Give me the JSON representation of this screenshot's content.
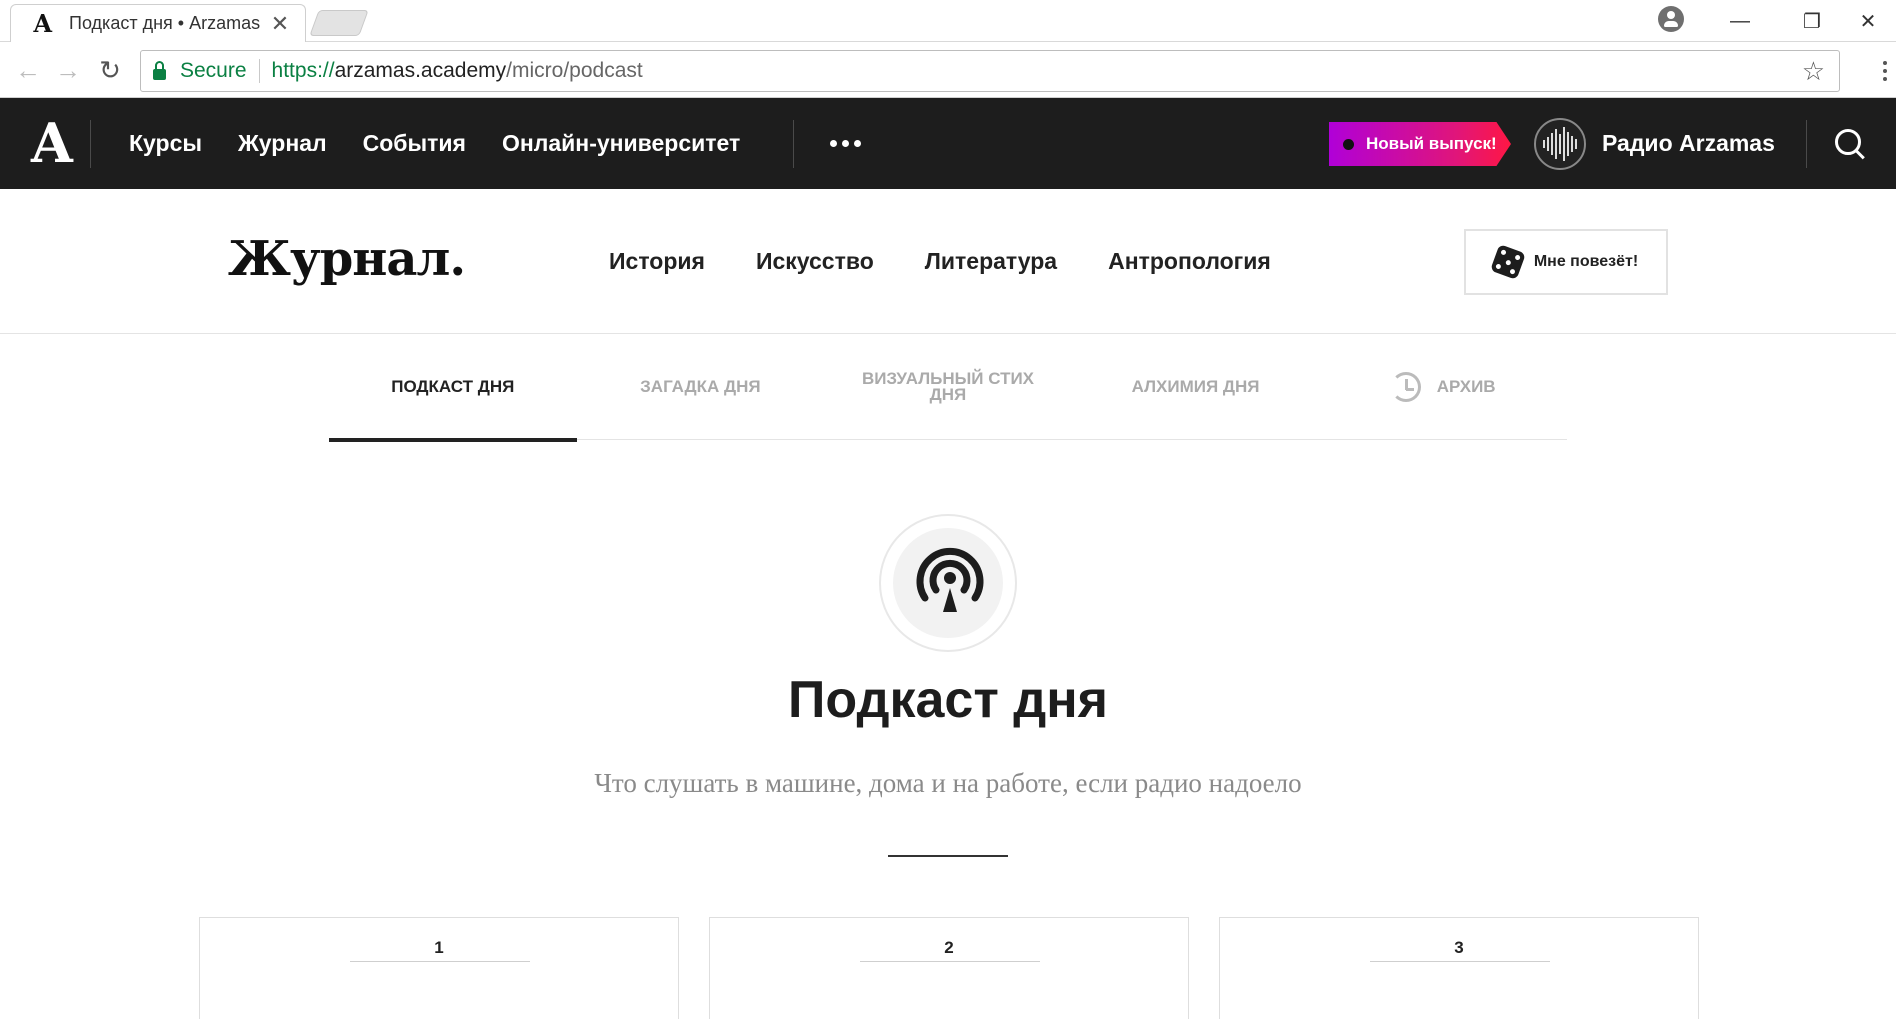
{
  "browser": {
    "tab_title": "Подкаст дня • Arzamas",
    "tab_favicon": "А",
    "secure_label": "Secure",
    "url_proto": "https://",
    "url_host": "arzamas.academy",
    "url_path": "/micro/podcast"
  },
  "header": {
    "logo": "А",
    "nav": [
      "Курсы",
      "Журнал",
      "События",
      "Онлайн-университет"
    ],
    "new_badge": "Новый выпуск!",
    "radio_label": "Радио Arzamas"
  },
  "journal": {
    "logo": "Журнал.",
    "nav": [
      "История",
      "Искусство",
      "Литература",
      "Антропология"
    ],
    "lucky_label": "Мне повезёт!"
  },
  "tabs": [
    {
      "label": "Подкаст дня",
      "active": true
    },
    {
      "label": "Загадка дня",
      "active": false
    },
    {
      "label": "Визуальный стих дня",
      "active": false
    },
    {
      "label": "Алхимия дня",
      "active": false
    },
    {
      "label": "Архив",
      "active": false
    }
  ],
  "hero": {
    "title": "Подкаст дня",
    "subtitle": "Что слушать в машине, дома и на работе, если радио надоело"
  },
  "cards": [
    {
      "number": "1"
    },
    {
      "number": "2"
    },
    {
      "number": "3"
    }
  ],
  "colors": {
    "header_bg": "#1d1d1d",
    "badge_gradient_start": "#b000d8",
    "badge_gradient_end": "#ff1744",
    "secure_green": "#0b8043"
  }
}
